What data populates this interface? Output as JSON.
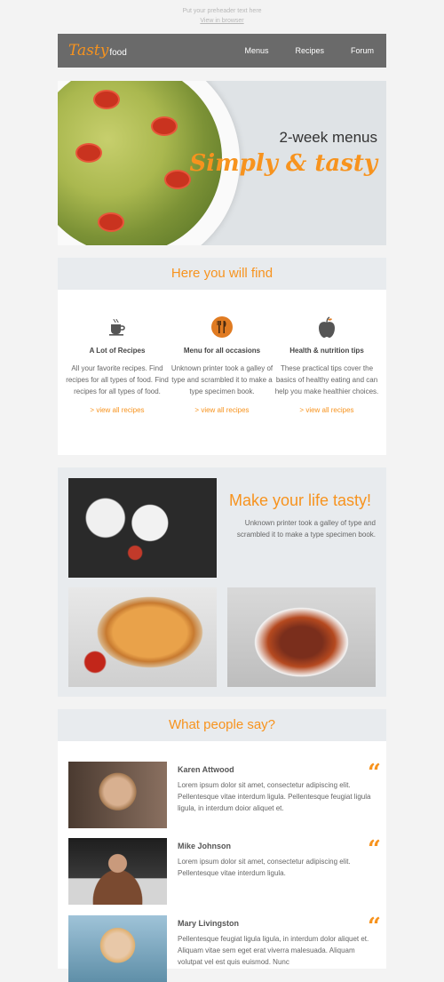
{
  "preheader": {
    "text": "Put your preheader text here",
    "view_link": "View in browser"
  },
  "header": {
    "logo_script": "Tasty",
    "logo_word": "food",
    "nav": [
      "Menus",
      "Recipes",
      "Forum"
    ]
  },
  "hero": {
    "line1": "2-week menus",
    "line2": "Simply & tasty"
  },
  "find": {
    "title": "Here you will find",
    "columns": [
      {
        "icon": "cup-icon",
        "title": "A Lot of Recipes",
        "desc": "All your favorite recipes. Find recipes for all types of food. Find recipes for all types of food.",
        "link": ">   view all recipes"
      },
      {
        "icon": "cutlery-icon",
        "title": "Menu for all occasions",
        "desc": "Unknown printer took a galley of type and scrambled it to make a type specimen book.",
        "link": ">   view all recipes"
      },
      {
        "icon": "apple-icon",
        "title": "Health & nutrition tips",
        "desc": "These practical tips cover the basics of healthy eating and can help you make healthier choices.",
        "link": ">   view all recipes"
      }
    ]
  },
  "tasty": {
    "title": "Make your life tasty!",
    "desc": "Unknown printer took a galley of type and scrambled it to make a type specimen book."
  },
  "people": {
    "title": "What people say?",
    "items": [
      {
        "name": "Karen Attwood",
        "text": "Lorem ipsum dolor sit amet, consectetur adipiscing elit. Pellentesque vitae interdum ligula. Pellentesque feugiat ligula ligula, in interdum doior aliquet et."
      },
      {
        "name": "Mike Johnson",
        "text": "Lorem ipsum dolor sit amet, consectetur adipiscing elit. Pellentesque vitae interdum ligula."
      },
      {
        "name": "Mary Livingston",
        "text": "Pellentesque feugiat ligula ligula, in interdum dolor aliquet et. Aliquam vitae sem eget erat viverra malesuada. Aliquam volutpat vel est quis euismod. Nunc"
      }
    ]
  },
  "colors": {
    "accent": "#f7931e",
    "header_bg": "#6a6a6a",
    "section_bg": "#e8ebee"
  }
}
